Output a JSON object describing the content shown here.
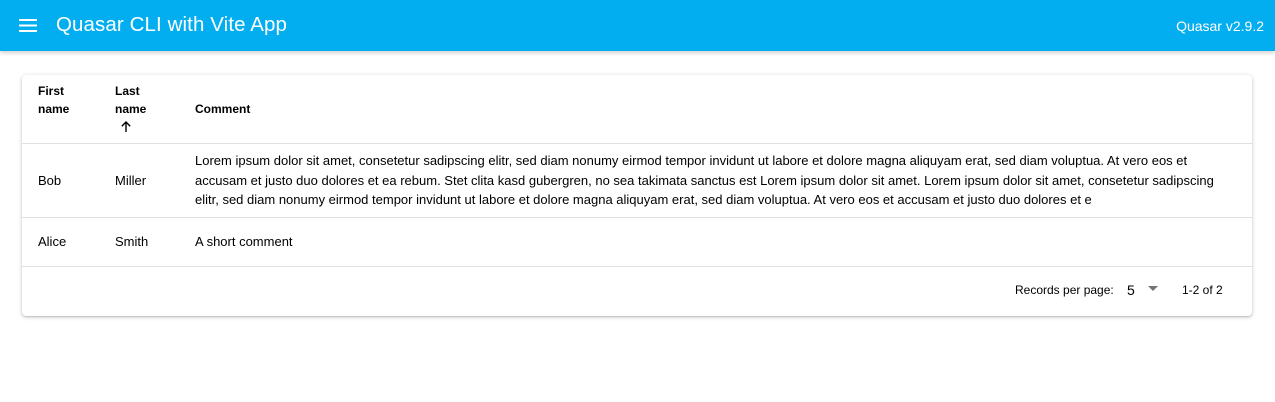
{
  "header": {
    "menu_icon": "menu-icon",
    "title": "Quasar CLI with Vite App",
    "version": "Quasar v2.9.2",
    "color": "#03aef0"
  },
  "table": {
    "columns": {
      "first_name_line1": "First",
      "first_name_line2": "name",
      "last_name_line1": "Last",
      "last_name_line2": "name",
      "comment": "Comment",
      "sort_icon": "arrow-upward-icon"
    },
    "rows": [
      {
        "first_name": "Bob",
        "last_name": "Miller",
        "comment": "Lorem ipsum dolor sit amet, consetetur sadipscing elitr, sed diam nonumy eirmod tempor invidunt ut labore et dolore magna aliquyam erat, sed diam voluptua. At vero eos et accusam et justo duo dolores et ea rebum. Stet clita kasd gubergren, no sea takimata sanctus est Lorem ipsum dolor sit amet. Lorem ipsum dolor sit amet, consetetur sadipscing elitr, sed diam nonumy eirmod tempor invidunt ut labore et dolore magna aliquyam erat, sed diam voluptua. At vero eos et accusam et justo duo dolores et e"
      },
      {
        "first_name": "Alice",
        "last_name": "Smith",
        "comment": "A short comment"
      }
    ],
    "footer": {
      "records_per_page_label": "Records per page:",
      "records_per_page_value": "5",
      "dropdown_icon": "arrow-drop-down-icon",
      "pagination_info": "1-2 of 2"
    }
  }
}
